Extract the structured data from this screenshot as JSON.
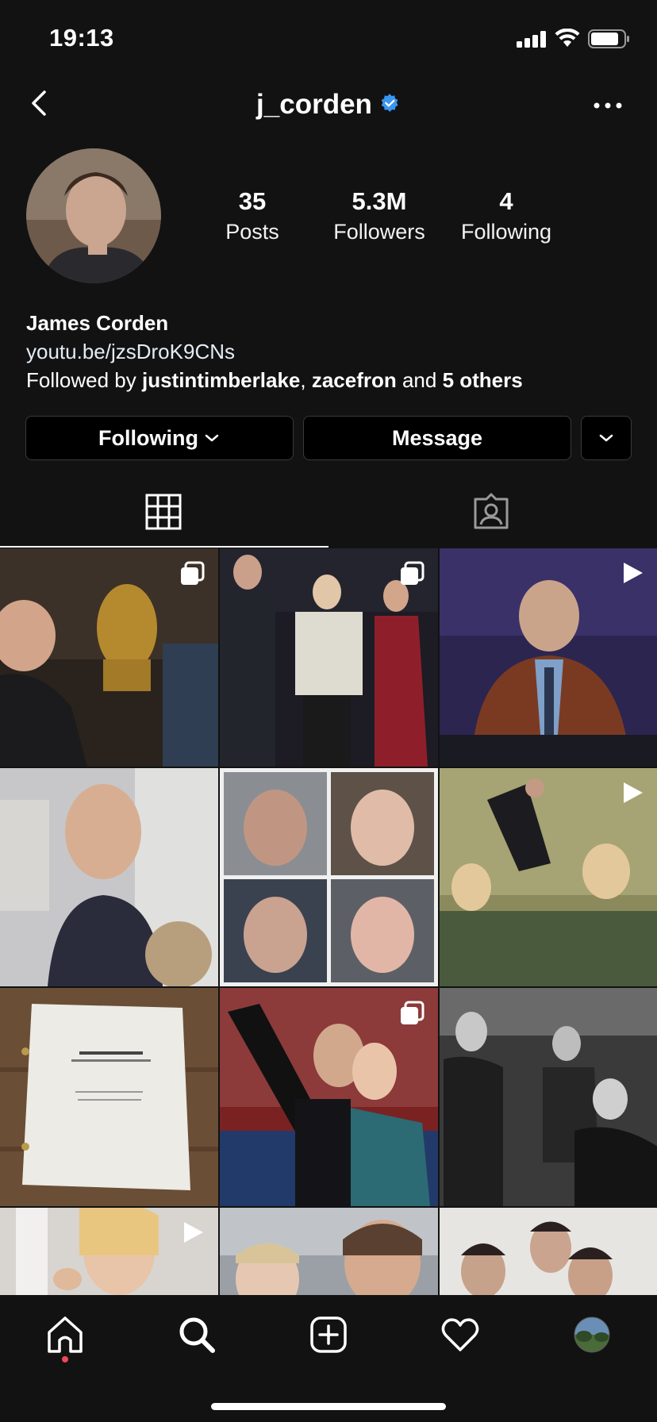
{
  "status_bar": {
    "time": "19:13"
  },
  "header": {
    "username": "j_corden",
    "verified": true
  },
  "profile": {
    "stats": [
      {
        "value": "35",
        "label": "Posts"
      },
      {
        "value": "5.3M",
        "label": "Followers"
      },
      {
        "value": "4",
        "label": "Following"
      }
    ],
    "full_name": "James Corden",
    "link": "youtu.be/jzsDroK9CNs",
    "followed_by": {
      "prefix": "Followed by ",
      "user1": "justintimberlake",
      "sep": ", ",
      "user2": "zacefron",
      "and": " and ",
      "others": "5 others"
    }
  },
  "actions": {
    "following_label": "Following",
    "message_label": "Message"
  },
  "tabs": [
    {
      "icon": "grid-icon"
    },
    {
      "icon": "tagged-icon"
    }
  ],
  "posts": [
    {
      "overlay": "carousel"
    },
    {
      "overlay": "carousel"
    },
    {
      "overlay": "video"
    },
    {
      "overlay": "none"
    },
    {
      "overlay": "none"
    },
    {
      "overlay": "video"
    },
    {
      "overlay": "none"
    },
    {
      "overlay": "carousel"
    },
    {
      "overlay": "none"
    },
    {
      "overlay": "video"
    },
    {
      "overlay": "none"
    },
    {
      "overlay": "none"
    }
  ],
  "bottom_nav": [
    "home-icon",
    "search-icon",
    "new-post-icon",
    "activity-heart-icon",
    "profile-avatar"
  ],
  "colors": {
    "background": "#121212",
    "verified": "#3897f0",
    "notification_dot": "#ed4956"
  }
}
